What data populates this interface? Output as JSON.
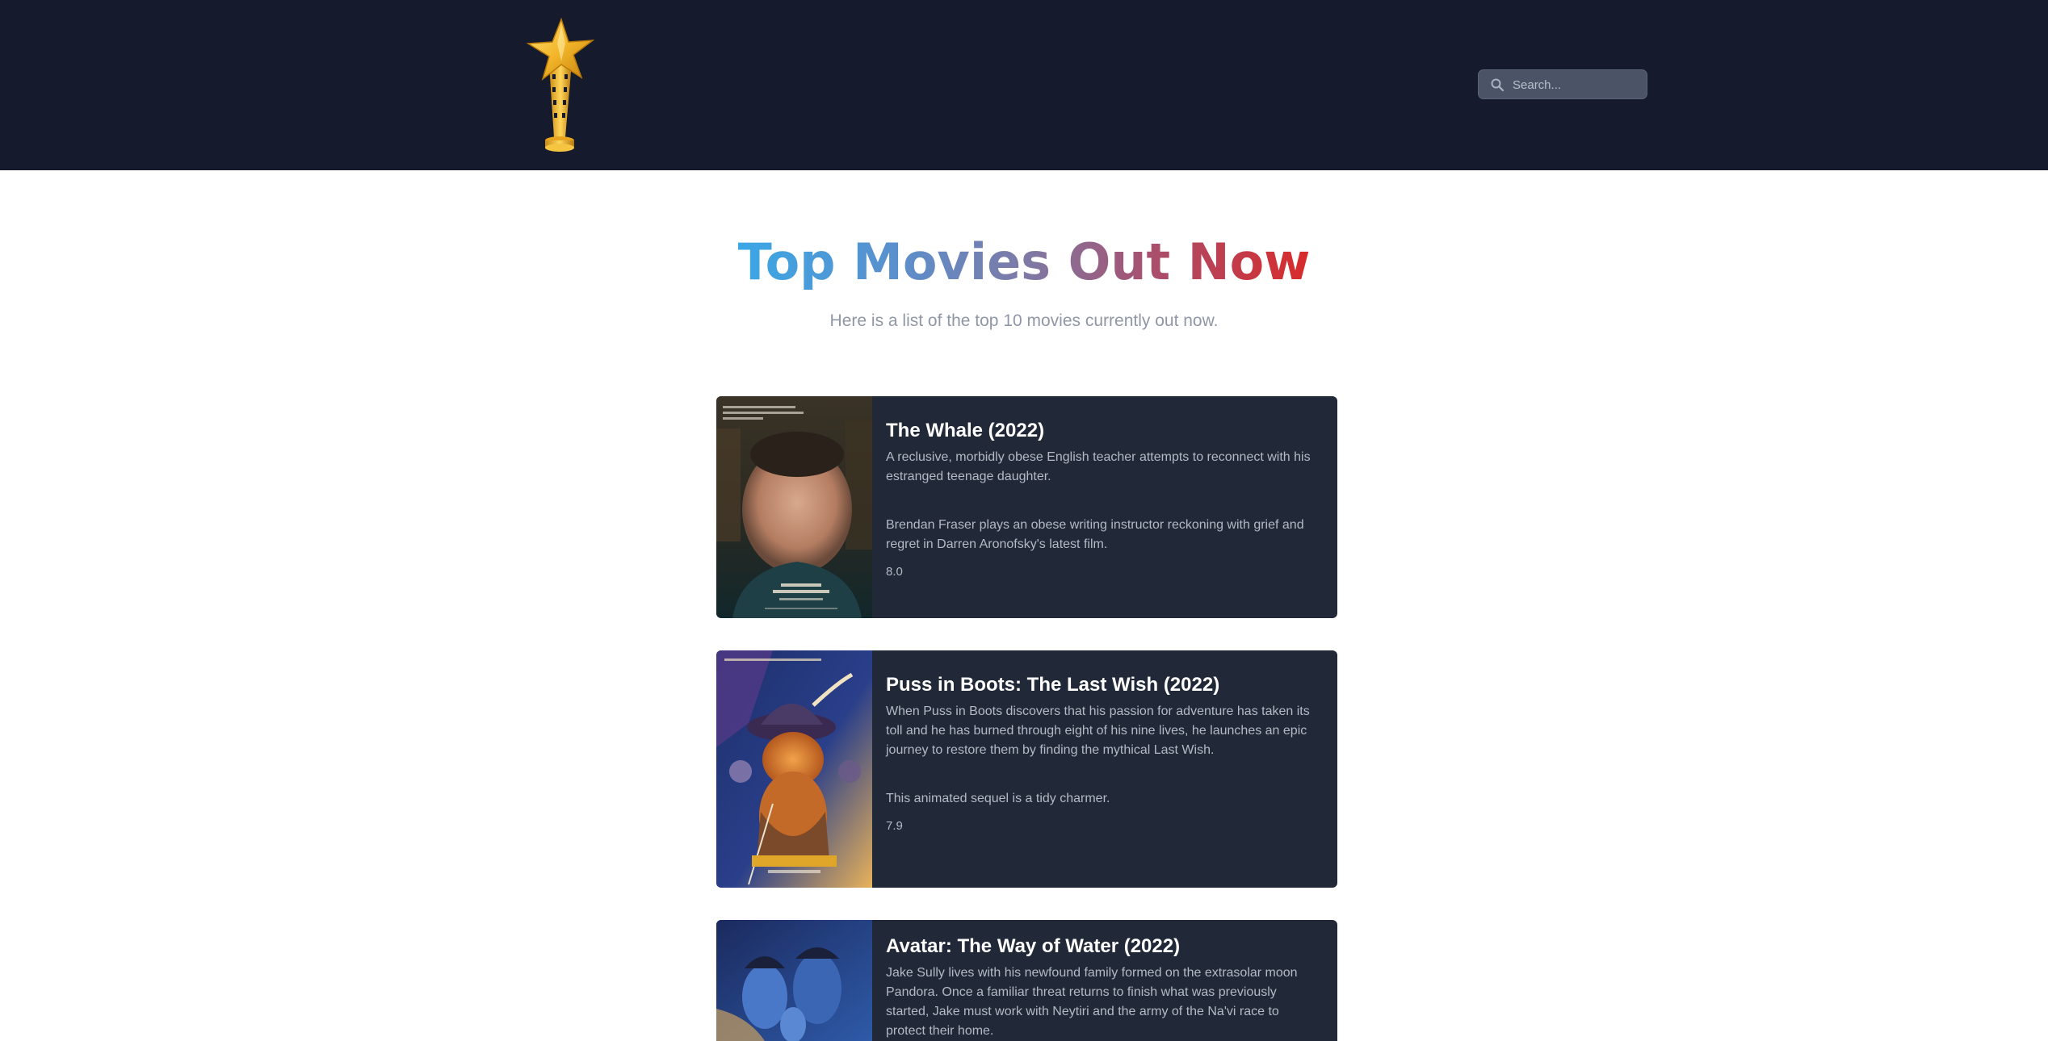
{
  "header": {
    "search_placeholder": "Search..."
  },
  "hero": {
    "title": "Top Movies Out Now",
    "subtitle": "Here is a list of the top 10 movies currently out now."
  },
  "movies": [
    {
      "title": "The Whale (2022)",
      "overview": "A reclusive, morbidly obese English teacher attempts to reconnect with his estranged teenage daughter.",
      "review": "Brendan Fraser plays an obese writing instructor reckoning with grief and regret in Darren Aronofsky's latest film.",
      "rating": "8.0"
    },
    {
      "title": "Puss in Boots: The Last Wish (2022)",
      "overview": "When Puss in Boots discovers that his passion for adventure has taken its toll and he has burned through eight of his nine lives, he launches an epic journey to restore them by finding the mythical Last Wish.",
      "review": "This animated sequel is a tidy charmer.",
      "rating": "7.9"
    },
    {
      "title": "Avatar: The Way of Water (2022)",
      "overview": "Jake Sully lives with his newfound family formed on the extrasolar moon Pandora. Once a familiar threat returns to finish what was previously started, Jake must work with Neytiri and the army of the Na'vi race to protect their home.",
      "review": "",
      "rating": ""
    }
  ]
}
